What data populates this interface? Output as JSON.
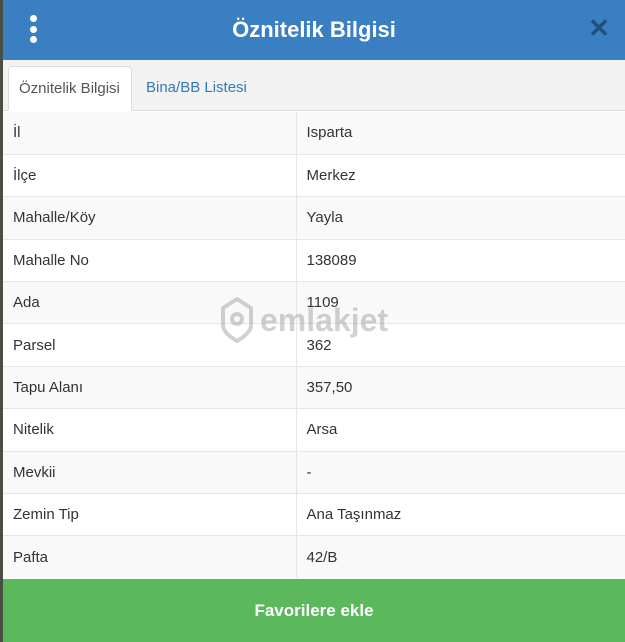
{
  "header": {
    "title": "Öznitelik Bilgisi",
    "menu_icon": "vertical-ellipsis-icon",
    "close_icon": "close-icon"
  },
  "tabs": [
    {
      "label": "Öznitelik Bilgisi",
      "active": true
    },
    {
      "label": "Bina/BB Listesi",
      "active": false
    }
  ],
  "rows": [
    {
      "key": "İl",
      "value": "Isparta"
    },
    {
      "key": "İlçe",
      "value": "Merkez"
    },
    {
      "key": "Mahalle/Köy",
      "value": "Yayla"
    },
    {
      "key": "Mahalle No",
      "value": "138089"
    },
    {
      "key": "Ada",
      "value": "1109"
    },
    {
      "key": "Parsel",
      "value": "362"
    },
    {
      "key": "Tapu Alanı",
      "value": "357,50"
    },
    {
      "key": "Nitelik",
      "value": "Arsa"
    },
    {
      "key": "Mevkii",
      "value": "-"
    },
    {
      "key": "Zemin Tip",
      "value": "Ana Taşınmaz"
    },
    {
      "key": "Pafta",
      "value": "42/B"
    }
  ],
  "watermark": {
    "text": "emlakjet"
  },
  "footer": {
    "button_label": "Favorilere ekle"
  },
  "colors": {
    "header": "#3a7fc1",
    "footer": "#5cb85c",
    "tab_link": "#337ab7"
  }
}
